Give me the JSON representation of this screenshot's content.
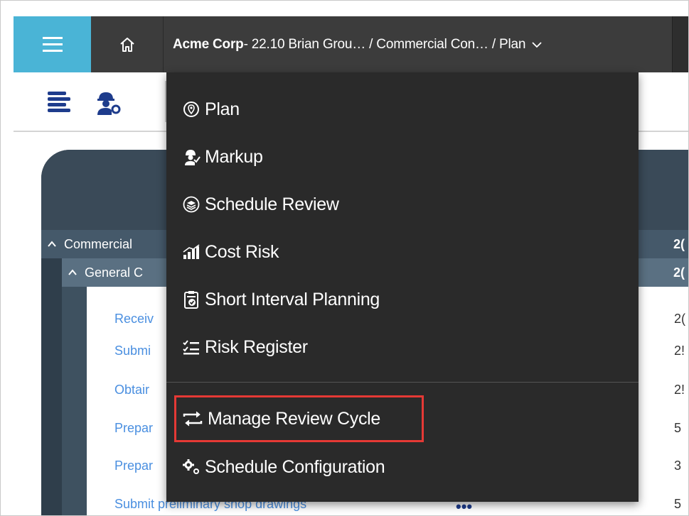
{
  "topbar": {
    "breadcrumb_company": "Acme Corp",
    "breadcrumb_rest": " - 22.10 Brian Grou… / Commercial Con… / Plan"
  },
  "menu": {
    "items": [
      {
        "label": "Plan",
        "icon": "location-pin-icon"
      },
      {
        "label": "Markup",
        "icon": "worker-check-icon"
      },
      {
        "label": "Schedule Review",
        "icon": "layers-icon"
      },
      {
        "label": "Cost Risk",
        "icon": "chart-bars-icon"
      },
      {
        "label": "Short Interval Planning",
        "icon": "clipboard-check-icon"
      },
      {
        "label": "Risk Register",
        "icon": "checklist-icon"
      },
      {
        "label": "Manage Review Cycle",
        "icon": "swap-arrows-icon"
      },
      {
        "label": "Schedule Configuration",
        "icon": "gears-icon"
      }
    ],
    "highlight_color": "#e53935"
  },
  "grid": {
    "group1_label": "Commercial",
    "group1_value": "2(",
    "group2_label": "General C",
    "group2_value": "2(",
    "leaf_rows": [
      {
        "label": "Receiv",
        "value": "2("
      },
      {
        "label": "Submi",
        "value": "2!"
      },
      {
        "label": "Obtair",
        "value": "2!"
      },
      {
        "label": "Prepar",
        "value": "5"
      },
      {
        "label": "Prepar",
        "value": "3"
      },
      {
        "label": "Submit preliminary shop drawings",
        "value": "5"
      }
    ]
  },
  "colors": {
    "accent": "#4ab4d6",
    "topbar": "#3c3c3c",
    "menu_bg": "#2a2a2a",
    "link": "#4a8fe0"
  }
}
